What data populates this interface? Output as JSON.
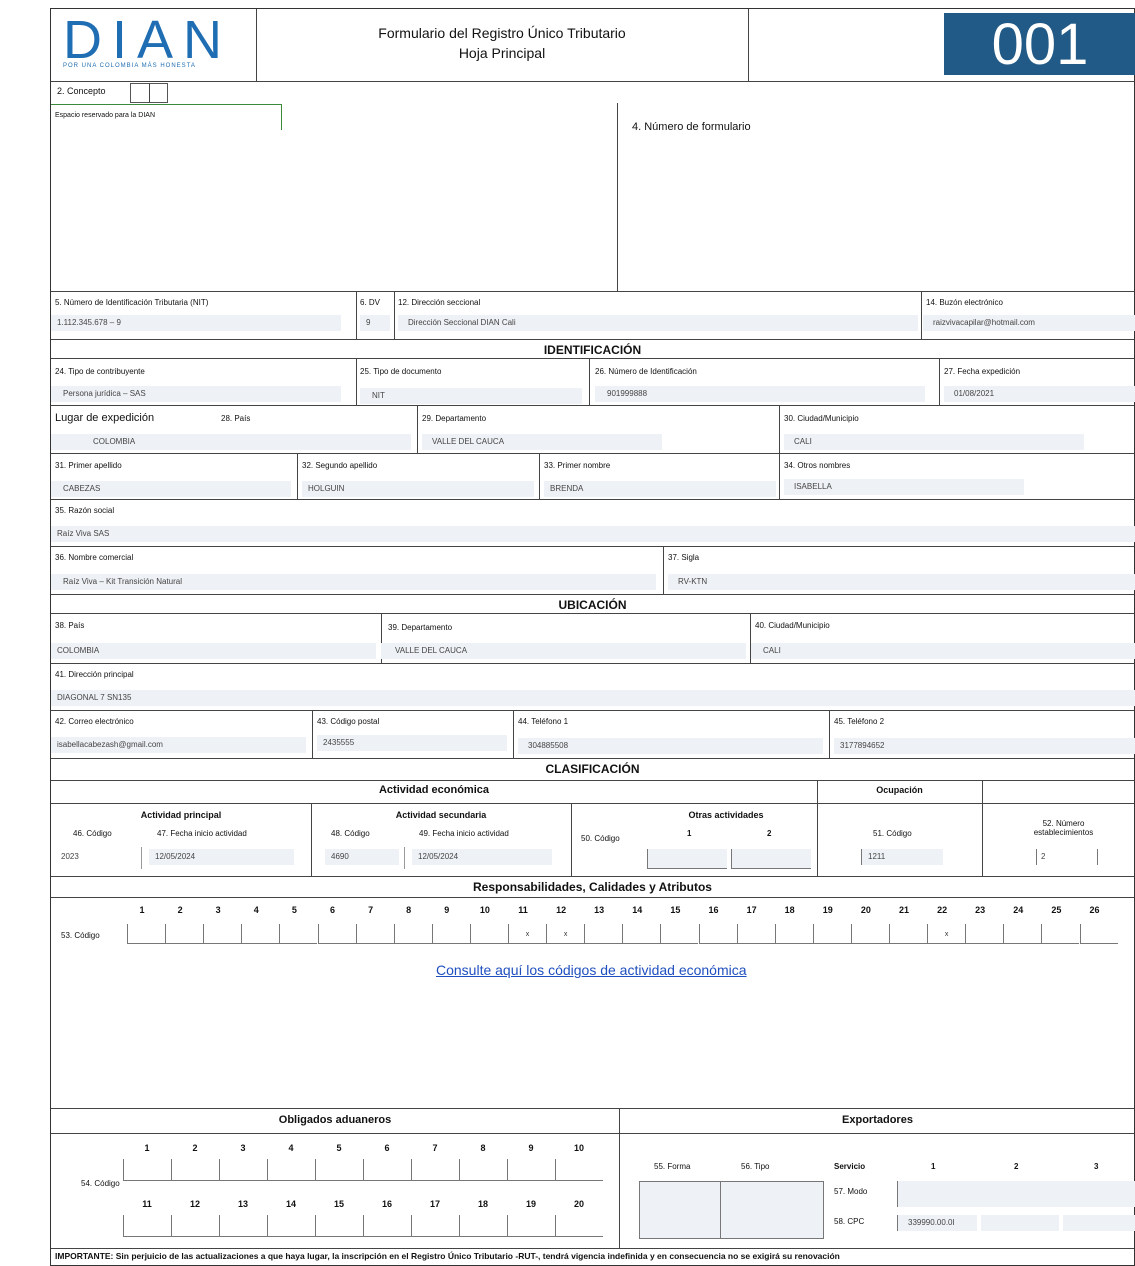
{
  "header": {
    "logo_word": "DIAN",
    "logo_tagline": "POR UNA COLOMBIA MÁS HONESTA",
    "title_line1": "Formulario del Registro Único Tributario",
    "title_line2": "Hoja Principal",
    "form_number": "001"
  },
  "concepto": {
    "label": "2. Concepto",
    "reserved": "Espacio reservado para la DIAN",
    "numero_formulario_label": "4. Número de formulario"
  },
  "nit_row": {
    "nit_label": "5. Número de Identificación Tributaria (NIT)",
    "nit_value": "1.112.345.678 – 9",
    "dv_label": "6. DV",
    "dv_value": "9",
    "seccional_label": "12. Dirección seccional",
    "seccional_value": "Dirección Seccional DIAN Cali",
    "buzon_label": "14. Buzón electrónico",
    "buzon_value": "raizvivacapilar@hotmail.com"
  },
  "identificacion": {
    "title": "IDENTIFICACIÓN",
    "tipo_contribuyente_label": "24. Tipo de contribuyente",
    "tipo_contribuyente_value": "Persona jurídica – SAS",
    "tipo_documento_label": "25. Tipo de documento",
    "tipo_documento_value": "NIT",
    "numero_id_label": "26. Número de Identificación",
    "numero_id_value": "901999888",
    "fecha_exp_label": "27. Fecha expedición",
    "fecha_exp_value": "01/08/2021",
    "lugar_label": "Lugar de expedición",
    "pais_label": "28. País",
    "pais_value": "COLOMBIA",
    "depto_label": "29. Departamento",
    "depto_value": "VALLE DEL CAUCA",
    "ciudad_label": "30. Ciudad/Municipio",
    "ciudad_value": "CALI",
    "apellido1_label": "31. Primer apellido",
    "apellido1_value": "CABEZAS",
    "apellido2_label": "32. Segundo apellido",
    "apellido2_value": "HOLGUIN",
    "nombre1_label": "33. Primer nombre",
    "nombre1_value": "BRENDA",
    "otros_label": "34. Otros nombres",
    "otros_value": "ISABELLA",
    "razon_label": "35. Razón social",
    "razon_value": "Raíz Viva SAS",
    "comercial_label": "36. Nombre comercial",
    "comercial_value": "Raíz Viva – Kit Transición Natural",
    "sigla_label": "37. Sigla",
    "sigla_value": "RV-KTN"
  },
  "ubicacion": {
    "title": "UBICACIÓN",
    "pais_label": "38. País",
    "pais_value": "COLOMBIA",
    "depto_label": "39. Departamento",
    "depto_value": "VALLE DEL CAUCA",
    "ciudad_label": "40. Ciudad/Municipio",
    "ciudad_value": "CALI",
    "direccion_label": "41. Dirección principal",
    "direccion_value": "DIAGONAL 7 SN135",
    "correo_label": "42. Correo electrónico",
    "correo_value": "isabellacabezash@gmail.com",
    "postal_label": "43. Código postal",
    "postal_value": "2435555",
    "tel1_label": "44. Teléfono 1",
    "tel1_value": "304885508",
    "tel2_label": "45. Teléfono 2",
    "tel2_value": "3177894652"
  },
  "clasificacion": {
    "title": "CLASIFICACIÓN",
    "actividad_title": "Actividad económica",
    "ocupacion_title": "Ocupación",
    "principal_title": "Actividad principal",
    "secundaria_title": "Actividad secundaria",
    "otras_title": "Otras actividades",
    "c46_label": "46. Código",
    "c46_value": "2023",
    "c47_label": "47. Fecha inicio actividad",
    "c47_value": "12/05/2024",
    "c48_label": "48. Código",
    "c48_value": "4690",
    "c49_label": "49. Fecha inicio actividad",
    "c49_value": "12/05/2024",
    "c50_label": "50. Código",
    "otras_1": "1",
    "otras_2": "2",
    "c51_label": "51. Código",
    "c51_value": "1211",
    "c52_label_1": "52. Número",
    "c52_label_2": "establecimientos",
    "c52_value": "2"
  },
  "responsabilidades": {
    "title": "Responsabilidades, Calidades y Atributos",
    "code_label": "53. Código",
    "numbers": [
      "1",
      "2",
      "3",
      "4",
      "5",
      "6",
      "7",
      "8",
      "9",
      "10",
      "11",
      "12",
      "13",
      "14",
      "15",
      "16",
      "17",
      "18",
      "19",
      "20",
      "21",
      "22",
      "23",
      "24",
      "25",
      "26"
    ],
    "cells": [
      "",
      "",
      "",
      "",
      "",
      "",
      "",
      "",
      "",
      "",
      "x",
      "x",
      "",
      "",
      "",
      "",
      "",
      "",
      "",
      "",
      "",
      "x",
      "",
      "",
      "",
      ""
    ],
    "link_text": "Consulte aquí los códigos de actividad económica"
  },
  "aduaneros": {
    "title": "Obligados aduaneros",
    "code_label": "54. Código",
    "numbers_top": [
      "1",
      "2",
      "3",
      "4",
      "5",
      "6",
      "7",
      "8",
      "9",
      "10"
    ],
    "numbers_bottom": [
      "11",
      "12",
      "13",
      "14",
      "15",
      "16",
      "17",
      "18",
      "19",
      "20"
    ]
  },
  "exportadores": {
    "title": "Exportadores",
    "forma_label": "55. Forma",
    "tipo_label": "56. Tipo",
    "servicio_label": "Servicio",
    "col1": "1",
    "col2": "2",
    "col3": "3",
    "modo_label": "57. Modo",
    "cpc_label": "58. CPC",
    "cpc_value": "339990.00.0I"
  },
  "footer": {
    "importante": "IMPORTANTE: Sin perjuicio de las actualizaciones a que haya lugar, la inscripción en el Registro Único Tributario -RUT-, tendrá vigencia indefinida y en consecuencia no se exigirá su renovación"
  }
}
